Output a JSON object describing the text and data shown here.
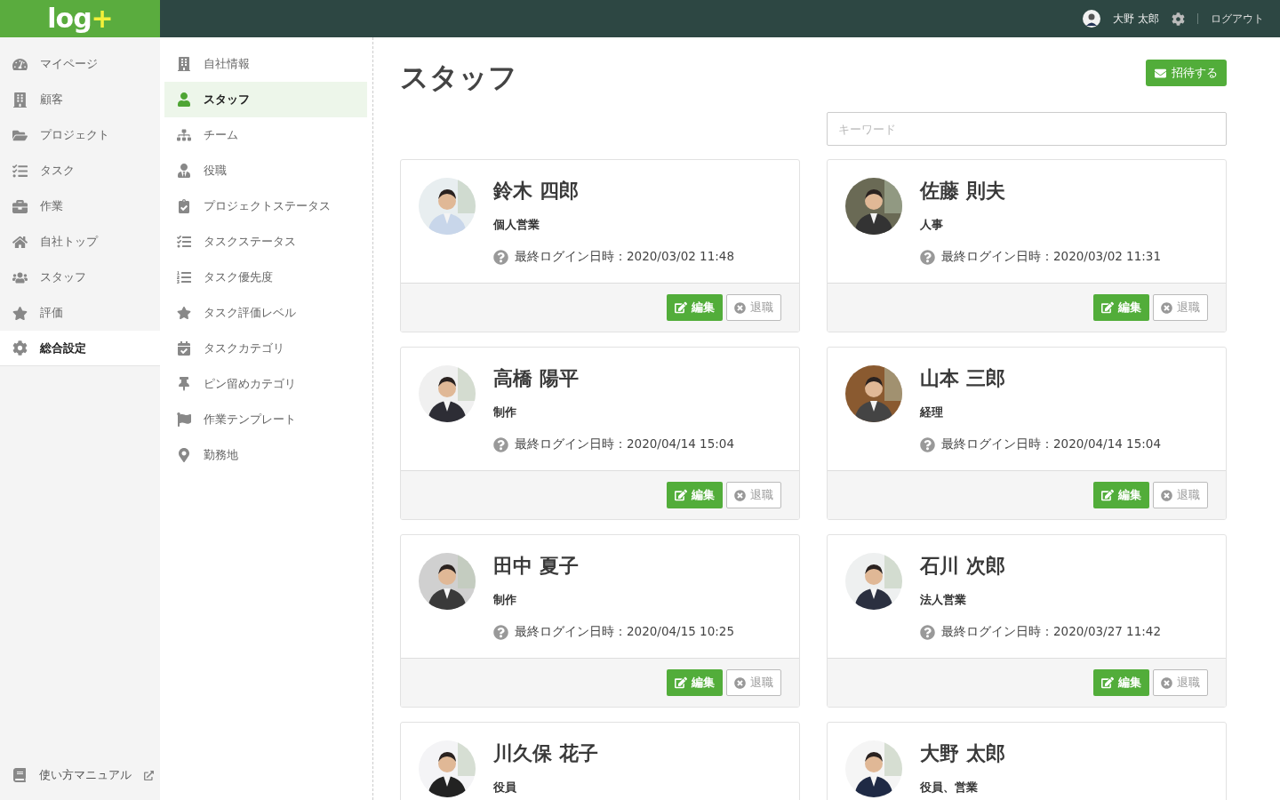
{
  "header": {
    "logo": "log",
    "logo_plus": "+",
    "user": "大野 太郎",
    "logout": "ログアウト"
  },
  "sidebar": {
    "items": [
      {
        "label": "マイページ",
        "selected": false
      },
      {
        "label": "顧客",
        "selected": false
      },
      {
        "label": "プロジェクト",
        "selected": false
      },
      {
        "label": "タスク",
        "selected": false
      },
      {
        "label": "作業",
        "selected": false
      },
      {
        "label": "自社トップ",
        "selected": false
      },
      {
        "label": "スタッフ",
        "selected": false
      },
      {
        "label": "評価",
        "selected": false
      },
      {
        "label": "総合設定",
        "selected": true
      }
    ],
    "footer_link": "使い方マニュアル"
  },
  "settings_menu": {
    "items": [
      {
        "label": "自社情報",
        "selected": false
      },
      {
        "label": "スタッフ",
        "selected": true
      },
      {
        "label": "チーム",
        "selected": false
      },
      {
        "label": "役職",
        "selected": false
      },
      {
        "label": "プロジェクトステータス",
        "selected": false
      },
      {
        "label": "タスクステータス",
        "selected": false
      },
      {
        "label": "タスク優先度",
        "selected": false
      },
      {
        "label": "タスク評価レベル",
        "selected": false
      },
      {
        "label": "タスクカテゴリ",
        "selected": false
      },
      {
        "label": "ピン留めカテゴリ",
        "selected": false
      },
      {
        "label": "作業テンプレート",
        "selected": false
      },
      {
        "label": "勤務地",
        "selected": false
      }
    ]
  },
  "page": {
    "title": "スタッフ",
    "invite_button": "招待する",
    "search": {
      "placeholder": "キーワード"
    }
  },
  "staff": [
    {
      "name": "鈴木 四郎",
      "role": "個人営業",
      "last_login": "最終ログイン日時：2020/03/02 11:48",
      "edit": "編集",
      "retire": "退職"
    },
    {
      "name": "佐藤 則夫",
      "role": "人事",
      "last_login": "最終ログイン日時：2020/03/02 11:31",
      "edit": "編集",
      "retire": "退職"
    },
    {
      "name": "高橋 陽平",
      "role": "制作",
      "last_login": "最終ログイン日時：2020/04/14 15:04",
      "edit": "編集",
      "retire": "退職"
    },
    {
      "name": "山本 三郎",
      "role": "経理",
      "last_login": "最終ログイン日時：2020/04/14 15:04",
      "edit": "編集",
      "retire": "退職"
    },
    {
      "name": "田中 夏子",
      "role": "制作",
      "last_login": "最終ログイン日時：2020/04/15 10:25",
      "edit": "編集",
      "retire": "退職"
    },
    {
      "name": "石川 次郎",
      "role": "法人営業",
      "last_login": "最終ログイン日時：2020/03/27 11:42",
      "edit": "編集",
      "retire": "退職"
    },
    {
      "name": "川久保 花子",
      "role": "役員"
    },
    {
      "name": "大野 太郎",
      "role": "役員、営業"
    }
  ]
}
